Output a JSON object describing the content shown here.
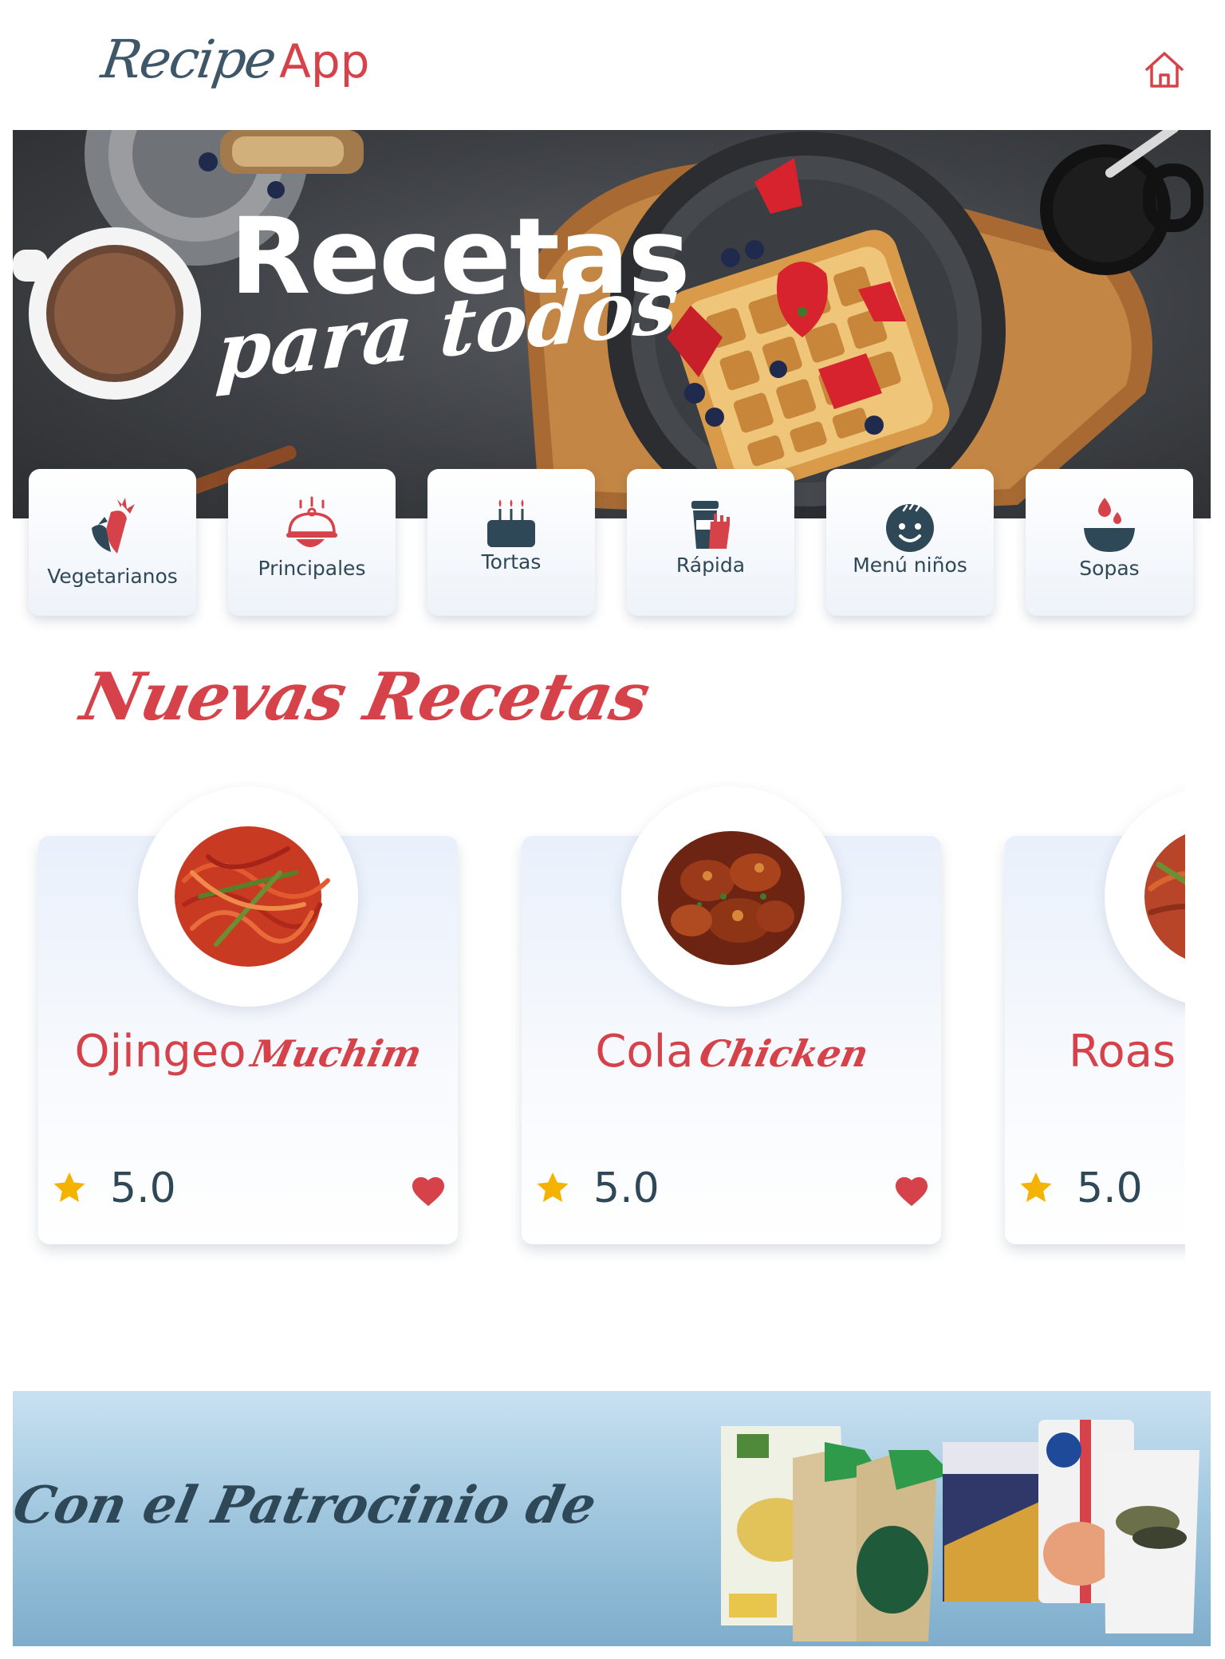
{
  "header": {
    "logo_script": "Recipe",
    "logo_app": "App",
    "home_icon": "home-icon"
  },
  "hero": {
    "title": "Recetas",
    "subtitle": "para todos"
  },
  "categories": [
    {
      "label": "Vegetarianos",
      "icon": "carrot-icon"
    },
    {
      "label": "Principales",
      "icon": "serving-dish-icon"
    },
    {
      "label": "Tortas",
      "icon": "cake-icon"
    },
    {
      "label": "Rápida",
      "icon": "fast-food-icon"
    },
    {
      "label": "Menú niños",
      "icon": "child-face-icon"
    },
    {
      "label": "Sopas",
      "icon": "soup-bowl-icon"
    }
  ],
  "section": {
    "title": "Nuevas Recetas"
  },
  "recipes": [
    {
      "title_main": "Ojingeo",
      "title_script": "Muchim",
      "rating": "5.0"
    },
    {
      "title_main": "Cola",
      "title_script": "Chicken",
      "rating": "5.0"
    },
    {
      "title_main": "Roas",
      "title_script": "",
      "rating": "5.0"
    }
  ],
  "sponsor": {
    "text": "Con el Patrocinio de"
  },
  "colors": {
    "accent": "#d6424a",
    "dark": "#2f4858",
    "star": "#f5b301"
  }
}
